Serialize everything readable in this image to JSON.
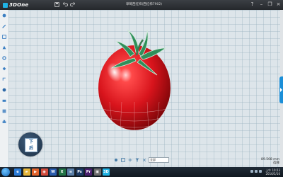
{
  "app": {
    "logo_text": "3DOne",
    "document_title": "草莓西红柿(西红柿7902)"
  },
  "titlebar": {
    "buttons": [
      "save-icon",
      "undo-icon",
      "redo-icon"
    ],
    "window_controls": [
      "help-icon",
      "minimize-icon",
      "restore-icon",
      "close-icon"
    ],
    "help_label": "?",
    "minimize_label": "–",
    "restore_label": "❐",
    "close_label": "×"
  },
  "left_toolbar": {
    "items": [
      "primitive-icon",
      "sketch-icon",
      "edit-sketch-icon",
      "feature-icon",
      "modify-icon",
      "assembly-icon",
      "measure-icon",
      "color-icon",
      "material-icon",
      "view-icon",
      "print-icon"
    ]
  },
  "view_cube": {
    "face_top": "下",
    "face_bottom": "后"
  },
  "bottom_toolbar": {
    "icons": [
      "render-icon",
      "view-mode-icon",
      "grid-icon",
      "filter-icon",
      "snap-icon"
    ],
    "select_value": "全部"
  },
  "status": {
    "zoom": "89.508 mm",
    "hint": "选择"
  },
  "taskbar": {
    "apps": [
      {
        "name": "ie-icon",
        "glyph": "e",
        "color": "#2b7bd6"
      },
      {
        "name": "folder-icon",
        "glyph": "▰",
        "color": "#e5b53a"
      },
      {
        "name": "media-icon",
        "glyph": "▶",
        "color": "#e0622b"
      },
      {
        "name": "chrome-icon",
        "glyph": "◉",
        "color": "#d04a3b"
      },
      {
        "name": "word-icon",
        "glyph": "W",
        "color": "#2a5cad"
      },
      {
        "name": "excel-icon",
        "glyph": "X",
        "color": "#217346"
      },
      {
        "name": "notepad-icon",
        "glyph": "≡",
        "color": "#5a7fa8"
      },
      {
        "name": "app-icon",
        "glyph": "Ps",
        "color": "#1c3b66"
      },
      {
        "name": "premiere-icon",
        "glyph": "Pr",
        "color": "#4a1f6d"
      },
      {
        "name": "tool-icon",
        "glyph": "▣",
        "color": "#6b6b6b"
      },
      {
        "name": "3done-icon",
        "glyph": "3D",
        "color": "#1fb3e5"
      }
    ],
    "time": "上午 10:23",
    "date": "2016/5/10"
  },
  "colors": {
    "accent": "#1fb3e5",
    "tomato": "#d8141c",
    "stem": "#2f8f5a"
  }
}
